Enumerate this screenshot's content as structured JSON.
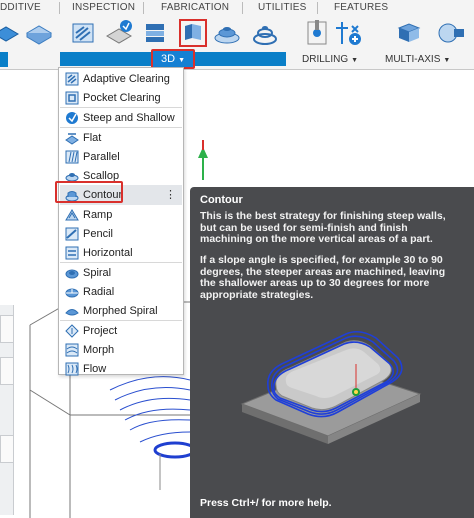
{
  "ribbon": {
    "tabs": [
      {
        "id": "additive",
        "label": "DDITIVE"
      },
      {
        "id": "inspection",
        "label": "INSPECTION"
      },
      {
        "id": "fabrication",
        "label": "FABRICATION"
      },
      {
        "id": "utilities",
        "label": "UTILITIES"
      },
      {
        "id": "features",
        "label": "FEATURES"
      }
    ],
    "group_3d_label": "3D",
    "group_drilling_label": "DRILLING",
    "group_multiaxis_label": "MULTI-AXIS",
    "caret": "▼",
    "accent_color": "#0a7fc8",
    "highlight_color": "#d9302c"
  },
  "menu": {
    "items": [
      {
        "id": "adaptive-clearing",
        "label": "Adaptive Clearing",
        "icon": "adaptive-clearing-icon"
      },
      {
        "id": "pocket-clearing",
        "label": "Pocket Clearing",
        "icon": "pocket-clearing-icon"
      },
      {
        "id": "steep-and-shallow",
        "label": "Steep and Shallow",
        "icon": "steep-and-shallow-icon"
      },
      {
        "id": "flat",
        "label": "Flat",
        "icon": "flat-icon"
      },
      {
        "id": "parallel",
        "label": "Parallel",
        "icon": "parallel-icon"
      },
      {
        "id": "scallop",
        "label": "Scallop",
        "icon": "scallop-icon"
      },
      {
        "id": "contour",
        "label": "Contour",
        "icon": "contour-icon"
      },
      {
        "id": "ramp",
        "label": "Ramp",
        "icon": "ramp-icon"
      },
      {
        "id": "pencil",
        "label": "Pencil",
        "icon": "pencil-icon"
      },
      {
        "id": "horizontal",
        "label": "Horizontal",
        "icon": "horizontal-icon"
      },
      {
        "id": "spiral",
        "label": "Spiral",
        "icon": "spiral-icon"
      },
      {
        "id": "radial",
        "label": "Radial",
        "icon": "radial-icon"
      },
      {
        "id": "morphed-spiral",
        "label": "Morphed Spiral",
        "icon": "morphed-spiral-icon"
      },
      {
        "id": "project",
        "label": "Project",
        "icon": "project-icon"
      },
      {
        "id": "morph",
        "label": "Morph",
        "icon": "morph-icon"
      },
      {
        "id": "flow",
        "label": "Flow",
        "icon": "flow-icon"
      }
    ],
    "highlighted_item": "contour",
    "more_glyph": "⋮"
  },
  "tooltip": {
    "title": "Contour",
    "paragraph1": "This is the best strategy for finishing steep walls, but can be used for semi-finish and finish machining on the more vertical areas of a part.",
    "paragraph2": "If a slope angle is specified, for example 30 to 90 degrees, the steeper areas are machined, leaving the shallower areas up to 30 degrees for more appropriate strategies.",
    "help_text": "Press Ctrl+/ for more help.",
    "image": "contour-toolpath-illustration"
  }
}
